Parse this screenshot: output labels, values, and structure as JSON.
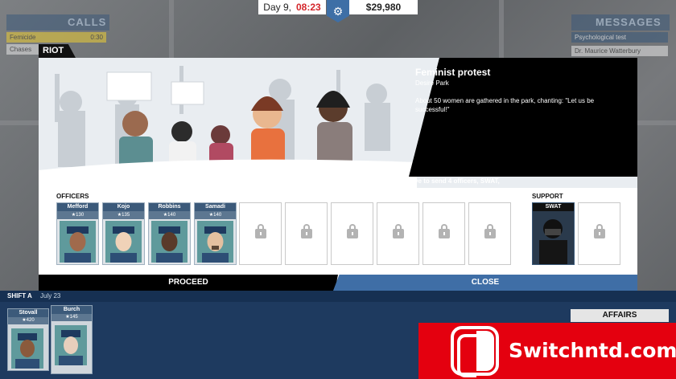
{
  "hud": {
    "day": "Day 9,",
    "time": "08:23",
    "money": "$29,980"
  },
  "side": {
    "calls_title": "CALLS",
    "call_items": [
      "Femicide",
      "Chases"
    ],
    "call_time": "0:30",
    "messages_title": "MESSAGES",
    "message_items": [
      "Psychological test",
      "Dr. Maurice Watterbury"
    ]
  },
  "dialog": {
    "tab": "RIOT",
    "title": "Feminist protest",
    "location": "Desire Park",
    "description": "About 50 women are gathered in the park, chanting: \"Let us be successful!\"",
    "requirement": "You have to send 4 officers, SWAT,",
    "officers_label": "OFFICERS",
    "support_label": "SUPPORT",
    "officers": [
      {
        "name": "Mefford",
        "rank": "★130"
      },
      {
        "name": "Kojo",
        "rank": "★135"
      },
      {
        "name": "Robbins",
        "rank": "★140"
      },
      {
        "name": "Samadi",
        "rank": "★140"
      }
    ],
    "swat_label": "SWAT",
    "proceed": "PROCEED",
    "close": "CLOSE"
  },
  "shift": {
    "label": "SHIFT A",
    "date": "July 23",
    "officers": [
      {
        "name": "Stovall",
        "rank": "★420"
      },
      {
        "name": "Burch",
        "rank": "★145"
      }
    ],
    "affairs": "AFFAIRS"
  },
  "watermark": {
    "text": "Switchntd.com"
  },
  "colors": {
    "accent": "#3f6ea6",
    "danger": "#d4262b",
    "watermark": "#e4000f"
  }
}
